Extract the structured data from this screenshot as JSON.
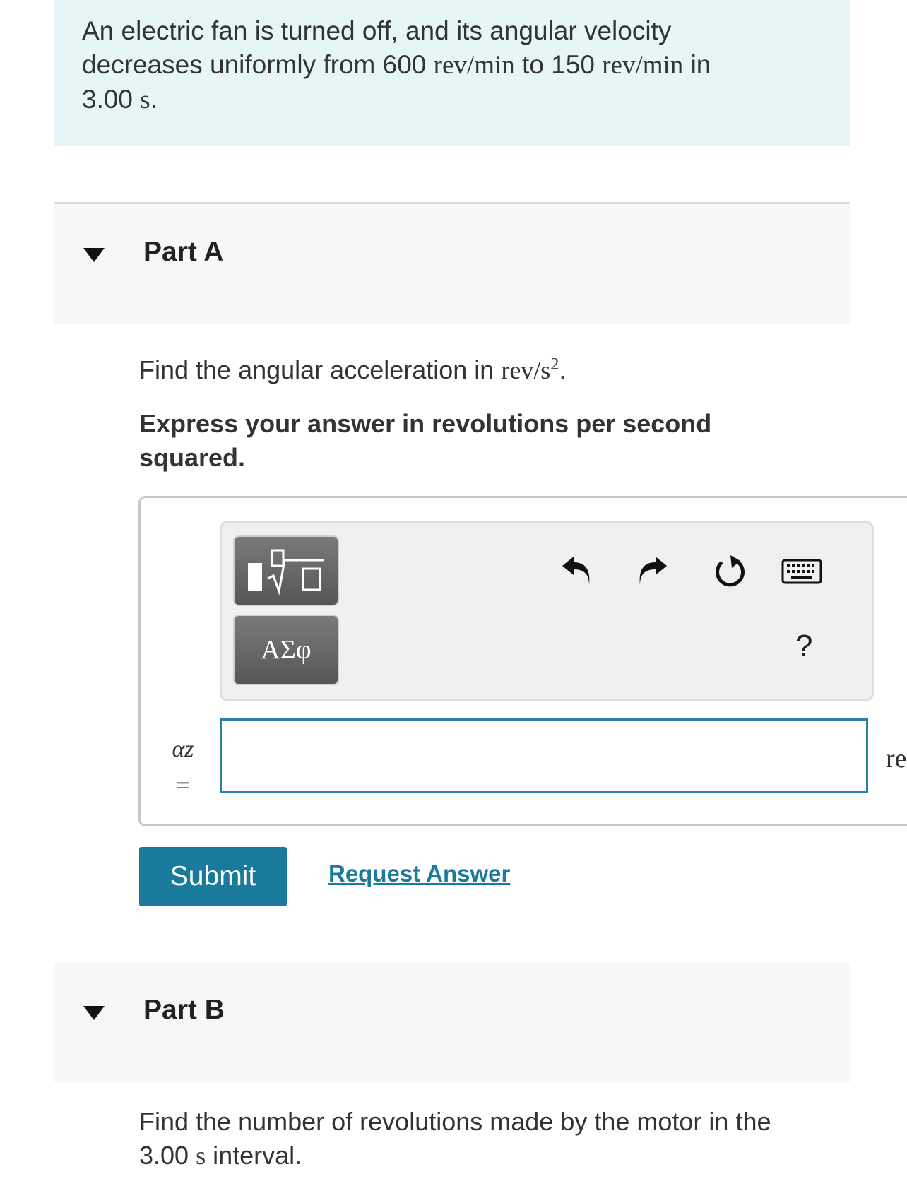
{
  "intro": {
    "line1": "An electric fan is turned off, and its angular velocity",
    "line2_a": "decreases uniformly from 600 ",
    "line2_unit1": "rev/min",
    "line2_b": " to 150 ",
    "line2_unit2": "rev/min",
    "line2_c": " in",
    "line3_a": "3.00 ",
    "line3_unit": "s",
    "line3_b": "."
  },
  "part_a": {
    "title": "Part A",
    "question_text": "Find the angular acceleration in ",
    "question_unit": "rev/s",
    "question_exp": "2",
    "question_end": ".",
    "instruction": "Express your answer in revolutions per second squared.",
    "variable": "αz",
    "equals": "=",
    "answer_value": "",
    "units_peek": "re",
    "toolbar": {
      "templates_icon": "fraction-sqrt-templates-icon",
      "symbols_label": "ΑΣφ",
      "undo_icon": "undo-icon",
      "redo_icon": "redo-icon",
      "reset_icon": "reset-icon",
      "keyboard_icon": "keyboard-icon",
      "help_label": "?"
    },
    "submit_label": "Submit",
    "request_answer_label": "Request Answer"
  },
  "part_b": {
    "title": "Part B",
    "question_a": "Find the number of revolutions made by the motor in the",
    "question_b_num": "3.00 ",
    "question_b_unit": "s",
    "question_b_end": " interval."
  },
  "colors": {
    "intro_bg": "#e6f6f6",
    "header_bg": "#f7f7f7",
    "accent": "#1a7a9b",
    "input_border": "#2d7fa6"
  }
}
